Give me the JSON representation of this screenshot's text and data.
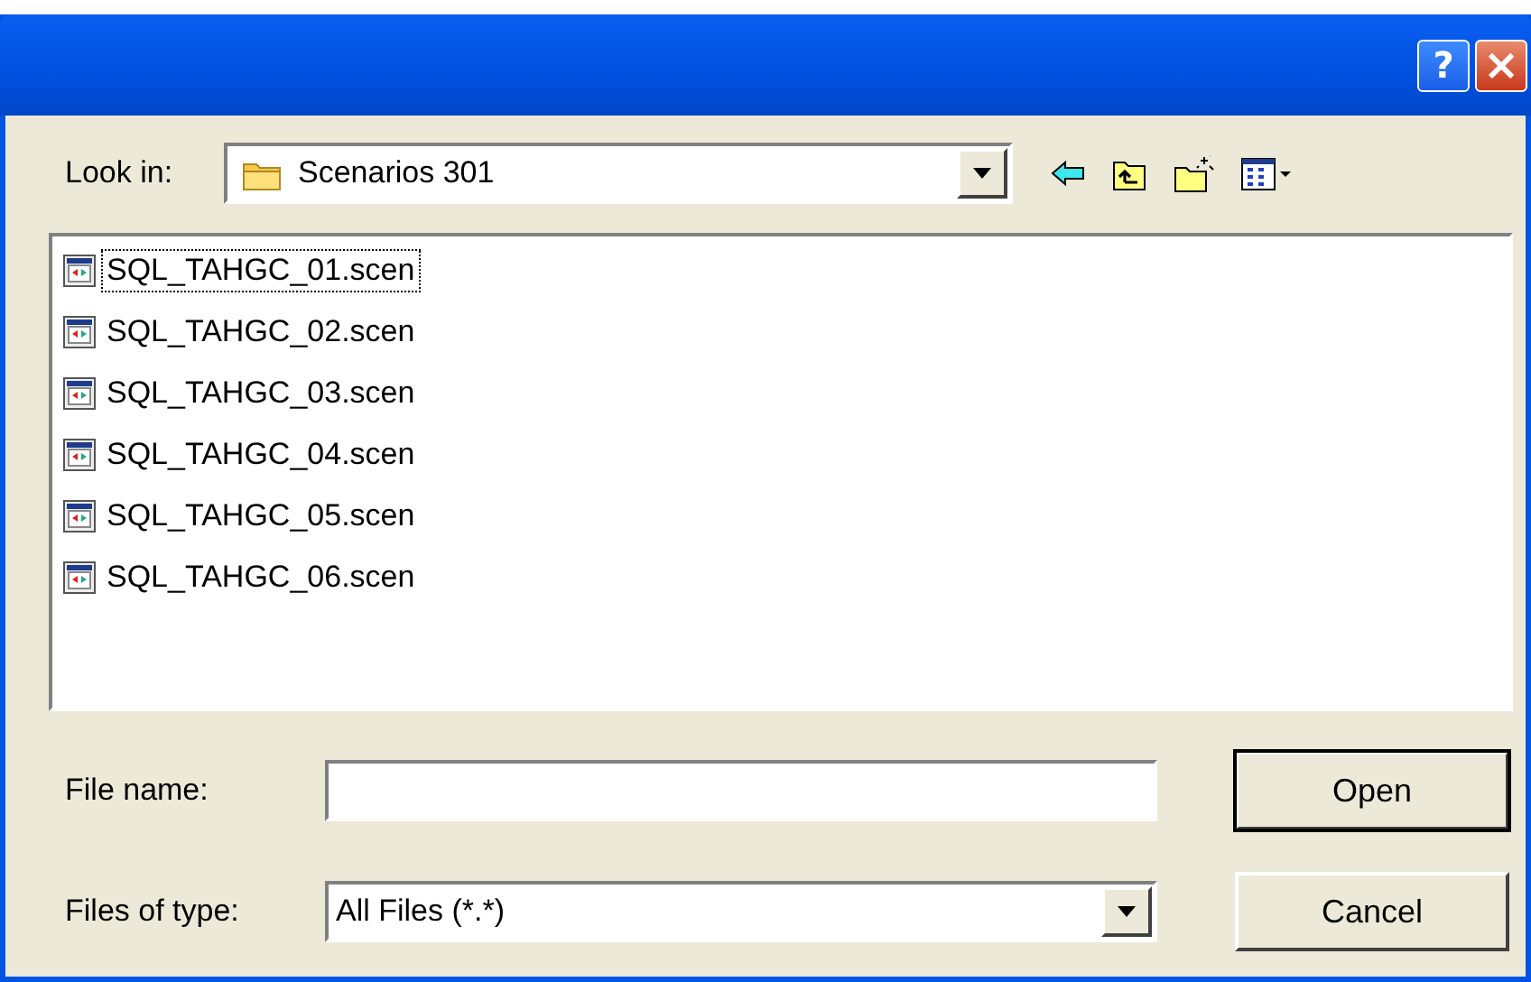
{
  "window": {
    "title_buttons": [
      {
        "kind": "help",
        "label": "?"
      },
      {
        "kind": "close",
        "label": "×"
      }
    ]
  },
  "look_in": {
    "label": "Look in:",
    "value": "Scenarios 301"
  },
  "files": [
    {
      "name": "SQL_TAHGC_01.scen",
      "focused": true
    },
    {
      "name": "SQL_TAHGC_02.scen",
      "focused": false
    },
    {
      "name": "SQL_TAHGC_03.scen",
      "focused": false
    },
    {
      "name": "SQL_TAHGC_04.scen",
      "focused": false
    },
    {
      "name": "SQL_TAHGC_05.scen",
      "focused": false
    },
    {
      "name": "SQL_TAHGC_06.scen",
      "focused": false
    }
  ],
  "file_name": {
    "label": "File name:"
  },
  "file_type": {
    "label": "Files of type:",
    "value": "All Files (*.*)"
  },
  "buttons": [
    {
      "label": "Open",
      "default": true
    },
    {
      "label": "Cancel",
      "default": false
    }
  ]
}
